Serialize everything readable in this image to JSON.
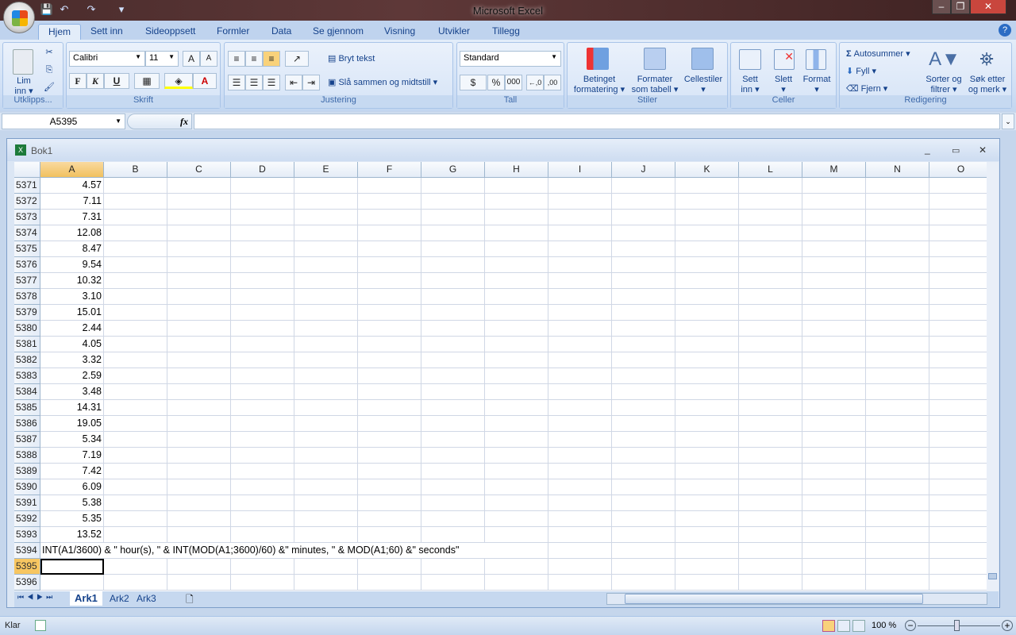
{
  "app": {
    "title": "Microsoft Excel"
  },
  "tabs": [
    "Hjem",
    "Sett inn",
    "Sideoppsett",
    "Formler",
    "Data",
    "Se gjennom",
    "Visning",
    "Utvikler",
    "Tillegg"
  ],
  "ribbon": {
    "clipboard": {
      "label": "Utklipps...",
      "paste": "Lim",
      "paste2": "inn"
    },
    "font": {
      "label": "Skrift",
      "name": "Calibri",
      "size": "11",
      "bold": "F",
      "italic": "K",
      "underline": "U"
    },
    "alignment": {
      "label": "Justering",
      "wrap": "Bryt tekst",
      "merge": "Slå sammen og midtstill"
    },
    "number": {
      "label": "Tall",
      "format": "Standard",
      "percent": "%",
      "thousands": "000"
    },
    "styles": {
      "label": "Stiler",
      "cond1": "Betinget",
      "cond2": "formatering",
      "table1": "Formater",
      "table2": "som tabell",
      "cellstyles": "Cellestiler"
    },
    "cells": {
      "label": "Celler",
      "insert1": "Sett",
      "insert2": "inn",
      "delete": "Slett",
      "format": "Format"
    },
    "editing": {
      "label": "Redigering",
      "autosum": "Autosummer",
      "fill": "Fyll",
      "clear": "Fjern",
      "sort1": "Sorter og",
      "sort2": "filtrer",
      "find1": "Søk etter",
      "find2": "og merk"
    }
  },
  "formula_bar": {
    "name_box": "A5395",
    "fx": "fx",
    "value": ""
  },
  "workbook": {
    "title": "Bok1"
  },
  "columns": [
    "A",
    "B",
    "C",
    "D",
    "E",
    "F",
    "G",
    "H",
    "I",
    "J",
    "K",
    "L",
    "M",
    "N",
    "O"
  ],
  "rows": [
    {
      "n": "5371",
      "a": "4.57"
    },
    {
      "n": "5372",
      "a": "7.11"
    },
    {
      "n": "5373",
      "a": "7.31"
    },
    {
      "n": "5374",
      "a": "12.08"
    },
    {
      "n": "5375",
      "a": "8.47"
    },
    {
      "n": "5376",
      "a": "9.54"
    },
    {
      "n": "5377",
      "a": "10.32"
    },
    {
      "n": "5378",
      "a": "3.10"
    },
    {
      "n": "5379",
      "a": "15.01"
    },
    {
      "n": "5380",
      "a": "2.44"
    },
    {
      "n": "5381",
      "a": "4.05"
    },
    {
      "n": "5382",
      "a": "3.32"
    },
    {
      "n": "5383",
      "a": "2.59"
    },
    {
      "n": "5384",
      "a": "3.48"
    },
    {
      "n": "5385",
      "a": "14.31"
    },
    {
      "n": "5386",
      "a": "19.05"
    },
    {
      "n": "5387",
      "a": "5.34"
    },
    {
      "n": "5388",
      "a": "7.19"
    },
    {
      "n": "5389",
      "a": "7.42"
    },
    {
      "n": "5390",
      "a": "6.09"
    },
    {
      "n": "5391",
      "a": "5.38"
    },
    {
      "n": "5392",
      "a": "5.35"
    },
    {
      "n": "5393",
      "a": "13.52"
    },
    {
      "n": "5394",
      "a": "INT(A1/3600) & \" hour(s), \" & INT(MOD(A1;3600)/60) &\" minutes, \" & MOD(A1;60) &\" seconds\"",
      "text": true
    },
    {
      "n": "5395",
      "a": "",
      "selected": true
    },
    {
      "n": "5396",
      "a": ""
    }
  ],
  "sheets": [
    "Ark1",
    "Ark2",
    "Ark3"
  ],
  "active_sheet": "Ark1",
  "status": {
    "ready": "Klar",
    "zoom": "100 %"
  }
}
